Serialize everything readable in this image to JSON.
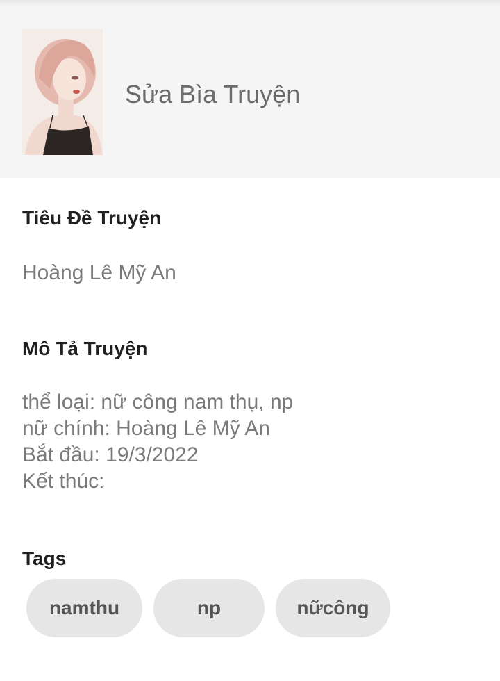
{
  "header": {
    "edit_cover_label": "Sửa Bìa Truyện"
  },
  "title_section": {
    "label": "Tiêu Đề Truyện",
    "value": "Hoàng Lê Mỹ An"
  },
  "description_section": {
    "label": "Mô Tả Truyện",
    "lines": [
      "thể loại: nữ công nam thụ, np",
      "nữ chính: Hoàng Lê Mỹ An",
      "Bắt đầu: 19/3/2022",
      "Kết thúc:"
    ]
  },
  "tags_section": {
    "label": "Tags",
    "tags": [
      "namthu",
      "np",
      "nữcông"
    ]
  }
}
